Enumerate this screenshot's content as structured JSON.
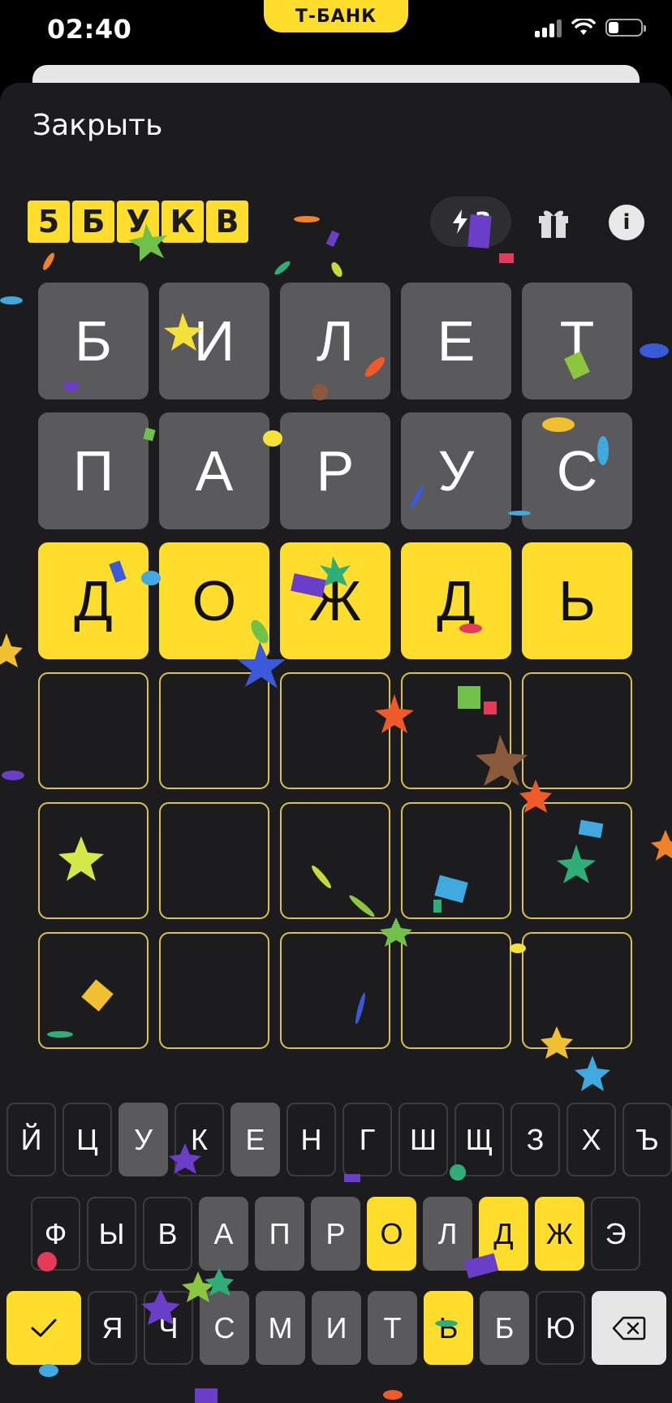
{
  "status_bar": {
    "time": "02:40",
    "brand": "Т-БАНК"
  },
  "header": {
    "close_label": "Закрыть"
  },
  "logo_letters": [
    "5",
    "Б",
    "У",
    "К",
    "В"
  ],
  "energy": {
    "count": "3"
  },
  "board": {
    "rows": [
      [
        "Б",
        "И",
        "Л",
        "Е",
        "Т"
      ],
      [
        "П",
        "А",
        "Р",
        "У",
        "С"
      ],
      [
        "Д",
        "О",
        "Ж",
        "Д",
        "Ь"
      ],
      [
        "",
        "",
        "",
        "",
        ""
      ],
      [
        "",
        "",
        "",
        "",
        ""
      ],
      [
        "",
        "",
        "",
        "",
        ""
      ]
    ]
  },
  "keyboard": {
    "row1": [
      "Й",
      "Ц",
      "У",
      "К",
      "Е",
      "Н",
      "Г",
      "Ш",
      "Щ",
      "З",
      "Х",
      "Ъ"
    ],
    "row2": [
      "Ф",
      "Ы",
      "В",
      "А",
      "П",
      "Р",
      "О",
      "Л",
      "Д",
      "Ж",
      "Э"
    ],
    "row3": [
      "Я",
      "Ч",
      "С",
      "М",
      "И",
      "Т",
      "Ь",
      "Б",
      "Ю"
    ]
  },
  "colors": {
    "accent": "#FFDD2D",
    "tile_absent": "#5A5A5C",
    "background": "#1C1C1E"
  },
  "icons": [
    "lightning-icon",
    "gift-icon",
    "info-icon",
    "check-icon",
    "backspace-icon"
  ]
}
